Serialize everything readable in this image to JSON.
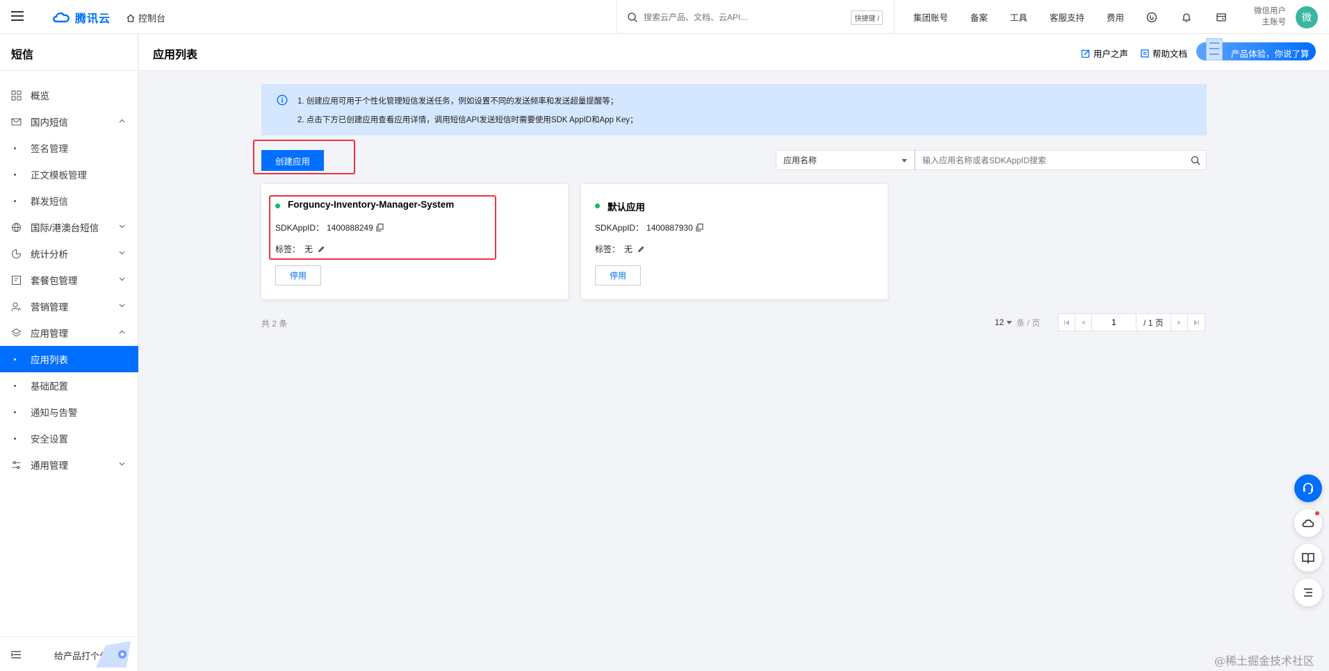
{
  "topbar": {
    "brand": "腾讯云",
    "console": "控制台",
    "search_placeholder": "搜索云产品、文档、云API...",
    "shortcut": "快捷键 /",
    "nav": [
      "集团账号",
      "备案",
      "工具",
      "客服支持",
      "费用"
    ],
    "user_line1": "微信用户",
    "user_line2": "主账号",
    "avatar": "微",
    "icons": [
      "wechat-icon",
      "bell-icon",
      "cart-icon"
    ]
  },
  "sidebar": {
    "title": "短信",
    "items": [
      {
        "label": "概览",
        "icon": "grid-icon"
      },
      {
        "label": "国内短信",
        "icon": "mail-icon",
        "expanded": true
      },
      {
        "label": "签名管理"
      },
      {
        "label": "正文模板管理"
      },
      {
        "label": "群发短信"
      },
      {
        "label": "国际/港澳台短信",
        "icon": "globe-icon"
      },
      {
        "label": "统计分析",
        "icon": "chart-icon"
      },
      {
        "label": "套餐包管理",
        "icon": "package-icon"
      },
      {
        "label": "营销管理",
        "icon": "users-icon"
      },
      {
        "label": "应用管理",
        "icon": "layers-icon",
        "expanded": true
      },
      {
        "label": "应用列表",
        "active": true
      },
      {
        "label": "基础配置"
      },
      {
        "label": "通知与告警"
      },
      {
        "label": "安全设置"
      },
      {
        "label": "通用管理",
        "icon": "sliders-icon"
      }
    ],
    "footer_label": "给产品打个分"
  },
  "header": {
    "title": "应用列表",
    "link_voice": "用户之声",
    "link_docs": "帮助文档",
    "feedback": "产品体验，你说了算"
  },
  "notice": {
    "line1": "1. 创建应用可用于个性化管理短信发送任务，例如设置不同的发送频率和发送超量提醒等；",
    "line2": "2. 点击下方已创建应用查看应用详情，调用短信API发送短信时需要使用SDK AppID和App Key；"
  },
  "toolbar": {
    "create_label": "创建应用",
    "filter_field": "应用名称",
    "search_placeholder": "输入应用名称或者SDKAppID搜索"
  },
  "apps": [
    {
      "name": "Forguncy-Inventory-Manager-System",
      "appid_label": "SDKAppID：",
      "appid": "1400888249",
      "tag_label": "标签：",
      "tag": "无",
      "action": "停用",
      "status_color": "#0abf5b"
    },
    {
      "name": "默认应用",
      "appid_label": "SDKAppID：",
      "appid": "1400887930",
      "tag_label": "标签：",
      "tag": "无",
      "action": "停用",
      "status_color": "#0abf5b"
    }
  ],
  "pagination": {
    "total": "共 2 条",
    "page_size": "12",
    "per_page": "条 / 页",
    "current_page": "1",
    "total_pages": "/ 1 页"
  },
  "watermark": "@稀土掘金技术社区",
  "colors": {
    "accent": "#006eff",
    "notice_bg": "#d5e7ff",
    "highlight": "#e8343e",
    "status": "#0abf5b"
  }
}
